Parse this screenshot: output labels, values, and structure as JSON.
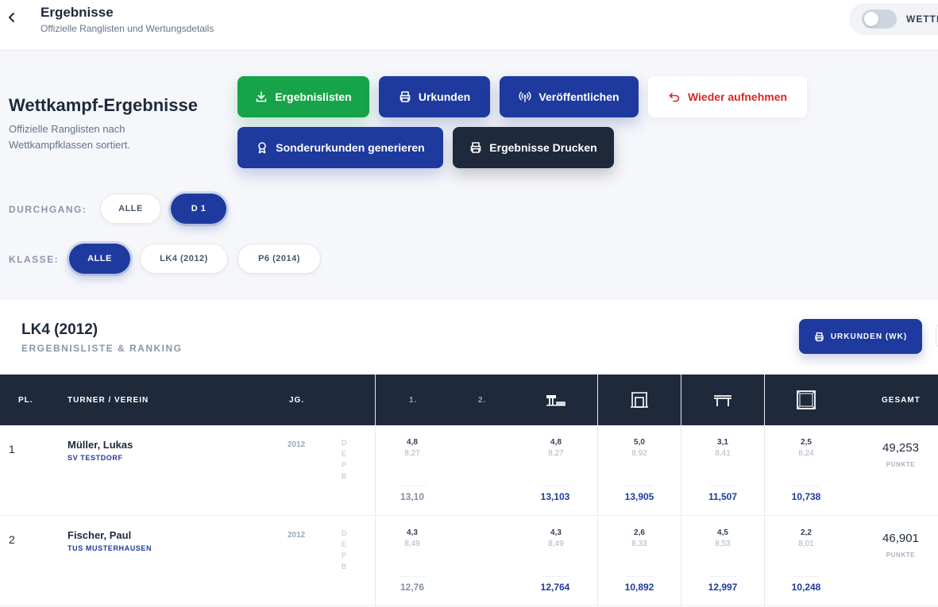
{
  "topbar": {
    "title": "Ergebnisse",
    "subtitle": "Offizielle Ranglisten und Wertungsdetails",
    "toggle_label": "WETTK"
  },
  "header": {
    "title": "Wettkampf-Ergebnisse",
    "subtitle": "Offizielle Ranglisten nach Wettkampfklassen sortiert."
  },
  "actions": {
    "ergebnislisten": "Ergebnislisten",
    "urkunden": "Urkunden",
    "veroeffentlichen": "Veröffentlichen",
    "wieder_aufnehmen": "Wieder aufnehmen",
    "sonderurkunden": "Sonderurkunden generieren",
    "drucken": "Ergebnisse Drucken"
  },
  "filters": {
    "durchgang_label": "DURCHGANG:",
    "durchgang_options": [
      "ALLE",
      "D 1"
    ],
    "durchgang_selected": "D 1",
    "klasse_label": "KLASSE:",
    "klasse_options": [
      "ALLE",
      "LK4 (2012)",
      "P6 (2014)"
    ],
    "klasse_selected": "ALLE"
  },
  "card": {
    "title": "LK4 (2012)",
    "subtitle": "ERGEBNISLISTE & RANKING",
    "button": "URKUNDEN (WK)"
  },
  "table": {
    "headers": {
      "pl": "PL.",
      "turner": "TURNER / VEREIN",
      "jg": "JG.",
      "run1": "1.",
      "run2": "2.",
      "gesamt": "GESAMT"
    },
    "apparatus_icons": [
      "vault-icon",
      "rings-icon",
      "parallel-bars-icon",
      "floor-icon"
    ],
    "score_labels": [
      "D",
      "E",
      "P",
      "B"
    ],
    "points_label": "PUNKTE",
    "rows": [
      {
        "place": "1",
        "name": "Müller, Lukas",
        "club": "SV TESTDORF",
        "year": "2012",
        "first": {
          "d": "4,8",
          "e": "8,27",
          "total": "13,10"
        },
        "apparatus": [
          {
            "d": "4,8",
            "e": "8,27",
            "total": "13,103"
          },
          {
            "d": "5,0",
            "e": "8,92",
            "total": "13,905"
          },
          {
            "d": "3,1",
            "e": "8,41",
            "total": "11,507"
          },
          {
            "d": "2,5",
            "e": "8,24",
            "total": "10,738"
          }
        ],
        "gesamt": "49,253"
      },
      {
        "place": "2",
        "name": "Fischer, Paul",
        "club": "TUS MUSTERHAUSEN",
        "year": "2012",
        "first": {
          "d": "4,3",
          "e": "8,49",
          "total": "12,76"
        },
        "apparatus": [
          {
            "d": "4,3",
            "e": "8,49",
            "total": "12,764"
          },
          {
            "d": "2,6",
            "e": "8,33",
            "total": "10,892"
          },
          {
            "d": "4,5",
            "e": "8,53",
            "total": "12,997"
          },
          {
            "d": "2,2",
            "e": "8,01",
            "total": "10,248"
          }
        ],
        "gesamt": "46,901"
      }
    ]
  },
  "colors": {
    "primary": "#1e3a9e",
    "success": "#16a34a",
    "dark": "#1e293b",
    "danger": "#dc2626"
  }
}
